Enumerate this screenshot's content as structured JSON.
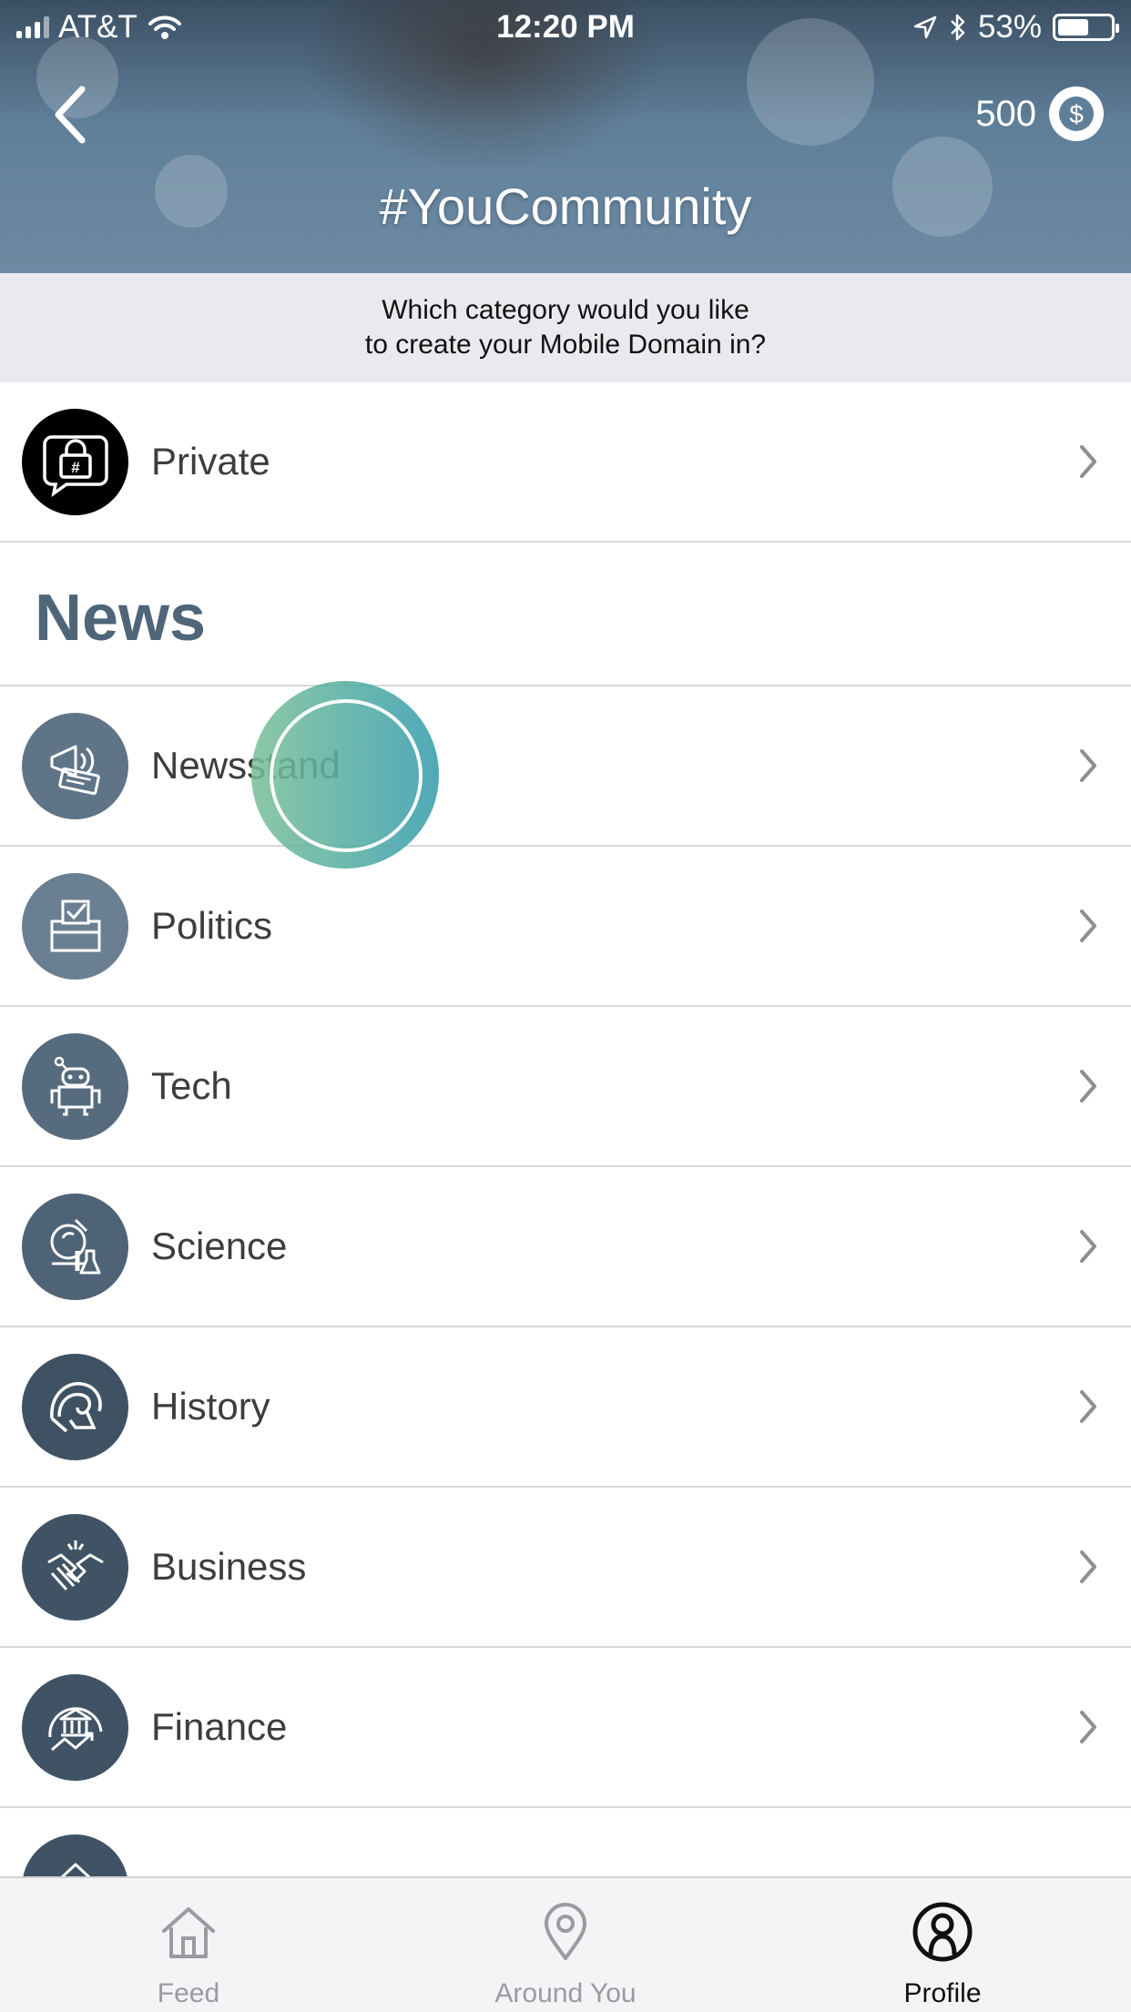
{
  "status_bar": {
    "carrier": "AT&T",
    "time": "12:20 PM",
    "battery": "53%",
    "battery_level": 0.53
  },
  "header": {
    "title": "#YouCommunity",
    "coins": "500",
    "back_icon": "chevron-left-icon",
    "coin_icon": "dollar-coin-icon"
  },
  "prompt": {
    "text": "Which category would you like\nto create your Mobile Domain in?"
  },
  "private_item": {
    "label": "Private",
    "icon": "lock-hashtag-icon"
  },
  "section": {
    "title": "News"
  },
  "categories": [
    {
      "label": "Newsstand",
      "icon": "megaphone-newspaper-icon"
    },
    {
      "label": "Politics",
      "icon": "ballot-box-icon"
    },
    {
      "label": "Tech",
      "icon": "robot-icon"
    },
    {
      "label": "Science",
      "icon": "microscope-flask-icon"
    },
    {
      "label": "History",
      "icon": "spartan-helmet-icon"
    },
    {
      "label": "Business",
      "icon": "handshake-icon"
    },
    {
      "label": "Finance",
      "icon": "bank-growth-icon"
    }
  ],
  "tabbar": {
    "tabs": [
      {
        "label": "Feed",
        "icon": "home-icon",
        "active": false
      },
      {
        "label": "Around You",
        "icon": "location-pin-icon",
        "active": false
      },
      {
        "label": "Profile",
        "icon": "profile-icon",
        "active": true
      }
    ]
  },
  "colors": {
    "icon_circle": "#5b6e80",
    "section_title": "#4f6578",
    "touch_start": "#78be96",
    "touch_end": "#3ca0af"
  }
}
